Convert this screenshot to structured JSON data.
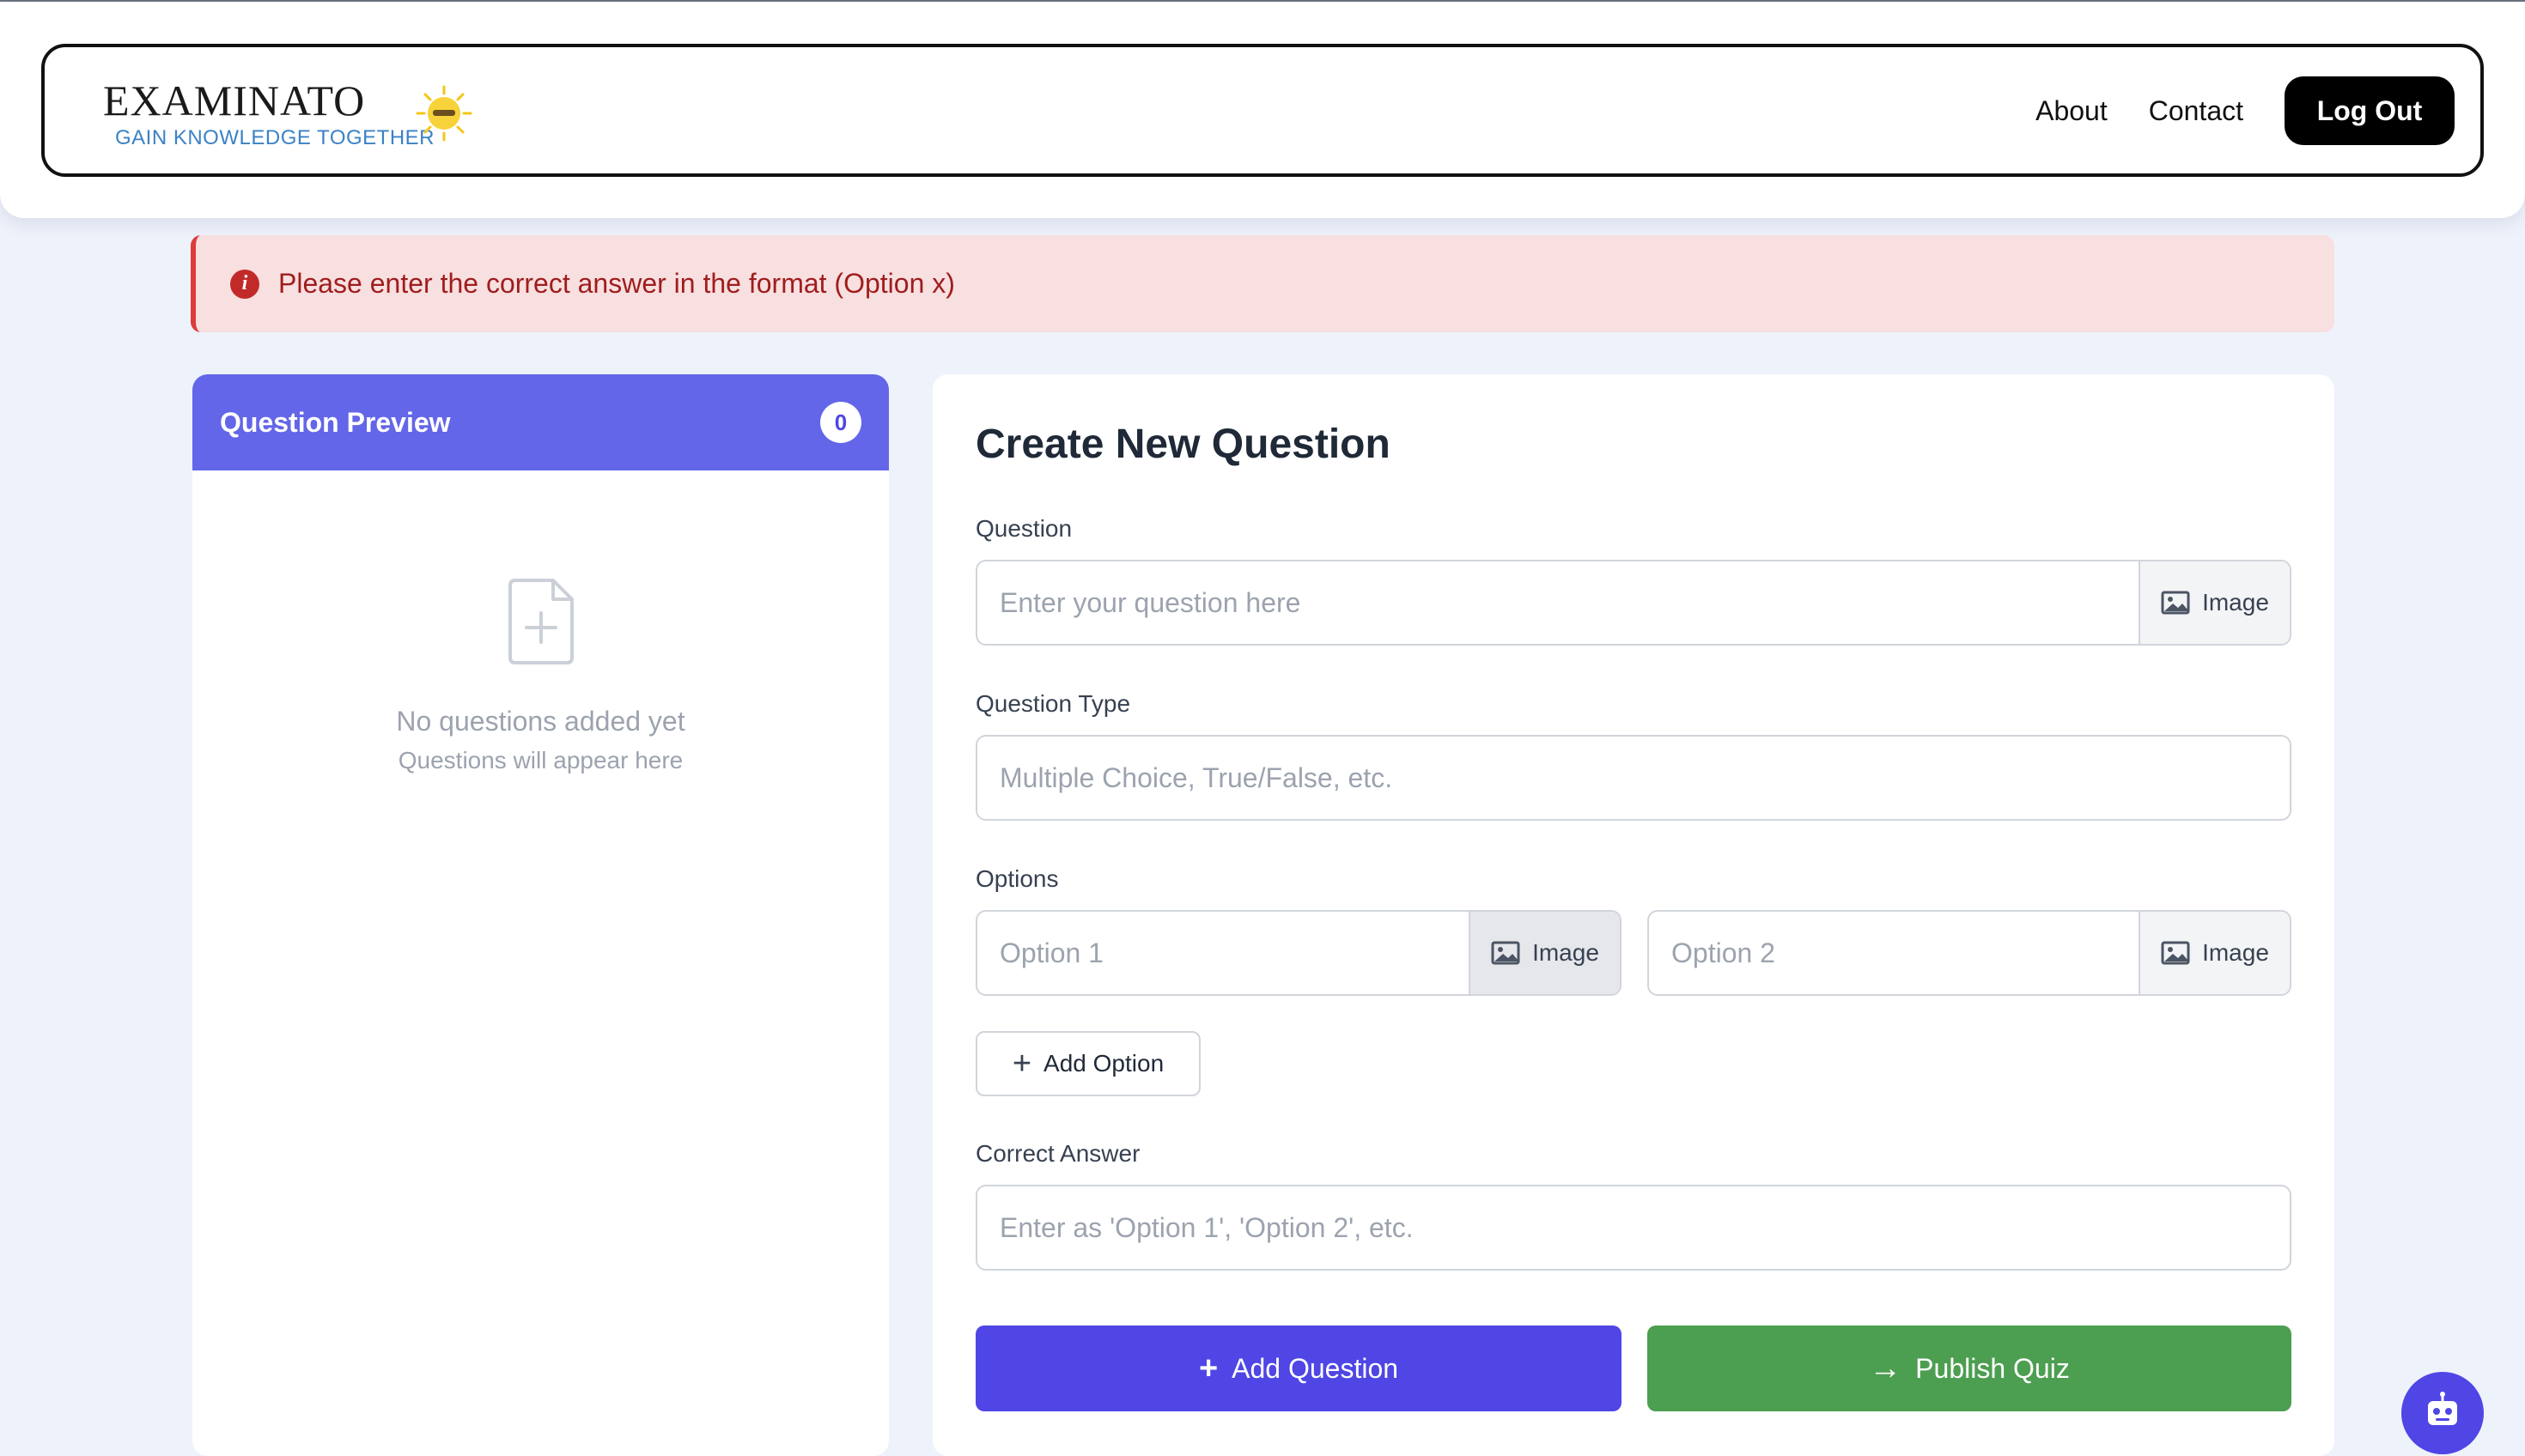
{
  "header": {
    "logo_title": "EXAMINATO",
    "logo_tagline": "GAIN KNOWLEDGE TOGETHER",
    "nav": [
      "About",
      "Contact"
    ],
    "logout_label": "Log Out"
  },
  "alert": {
    "message": "Please enter the correct answer in the format (Option x)"
  },
  "preview": {
    "title": "Question Preview",
    "count": "0",
    "empty_title": "No questions added yet",
    "empty_subtitle": "Questions will appear here"
  },
  "form": {
    "title": "Create New Question",
    "question_label": "Question",
    "question_placeholder": "Enter your question here",
    "image_label": "Image",
    "type_label": "Question Type",
    "type_placeholder": "Multiple Choice, True/False, etc.",
    "options_label": "Options",
    "options": [
      {
        "placeholder": "Option 1",
        "image_label": "Image"
      },
      {
        "placeholder": "Option 2",
        "image_label": "Image"
      }
    ],
    "add_option_label": "Add Option",
    "answer_label": "Correct Answer",
    "answer_placeholder": "Enter as 'Option 1', 'Option 2', etc.",
    "add_question_label": "Add Question",
    "publish_label": "Publish Quiz"
  },
  "colors": {
    "primary": "#4f46e5",
    "preview_header": "#6366e8",
    "publish": "#4c9e50",
    "alert_bg": "#f8dfe0",
    "alert_text": "#9f1d1d"
  }
}
